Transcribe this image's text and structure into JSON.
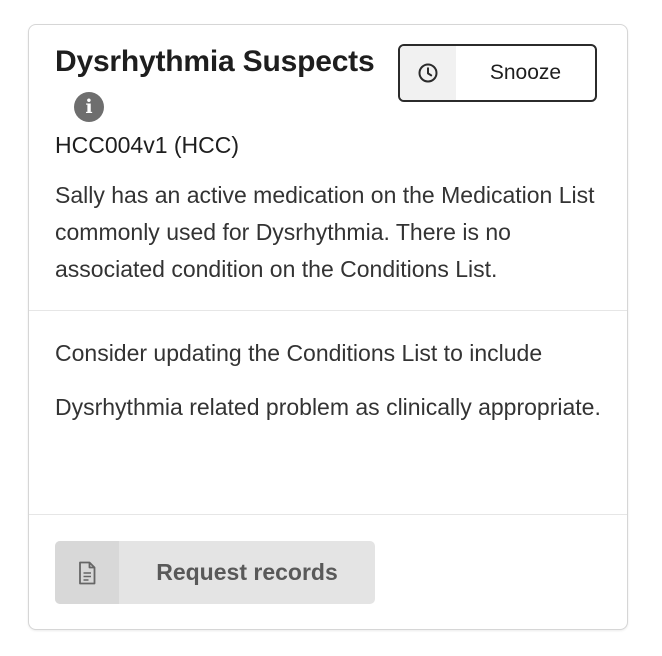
{
  "card": {
    "title": "Dysrhythmia Suspects",
    "info_icon": "info-circle-icon",
    "info_glyph": "i",
    "code": "HCC004v1 (HCC)",
    "description": "Sally has an active medication on the Medication List commonly used for Dysrhythmia. There is no associated condition on the Conditions List.",
    "recommendation": "Consider updating the Conditions List to include Dysrhythmia related problem as clinically appropriate."
  },
  "snooze_button": {
    "label": "Snooze",
    "icon": "clock-icon"
  },
  "request_button": {
    "label": "Request records",
    "icon": "document-icon"
  },
  "colors": {
    "title_text": "#1e1e1e",
    "body_text": "#333333",
    "info_icon_bg": "#6e6e6e",
    "request_button_bg": "#e4e4e4",
    "request_icon_bg": "#d8d8d8",
    "request_label": "#595959",
    "snooze_border": "#2b2b2b"
  }
}
